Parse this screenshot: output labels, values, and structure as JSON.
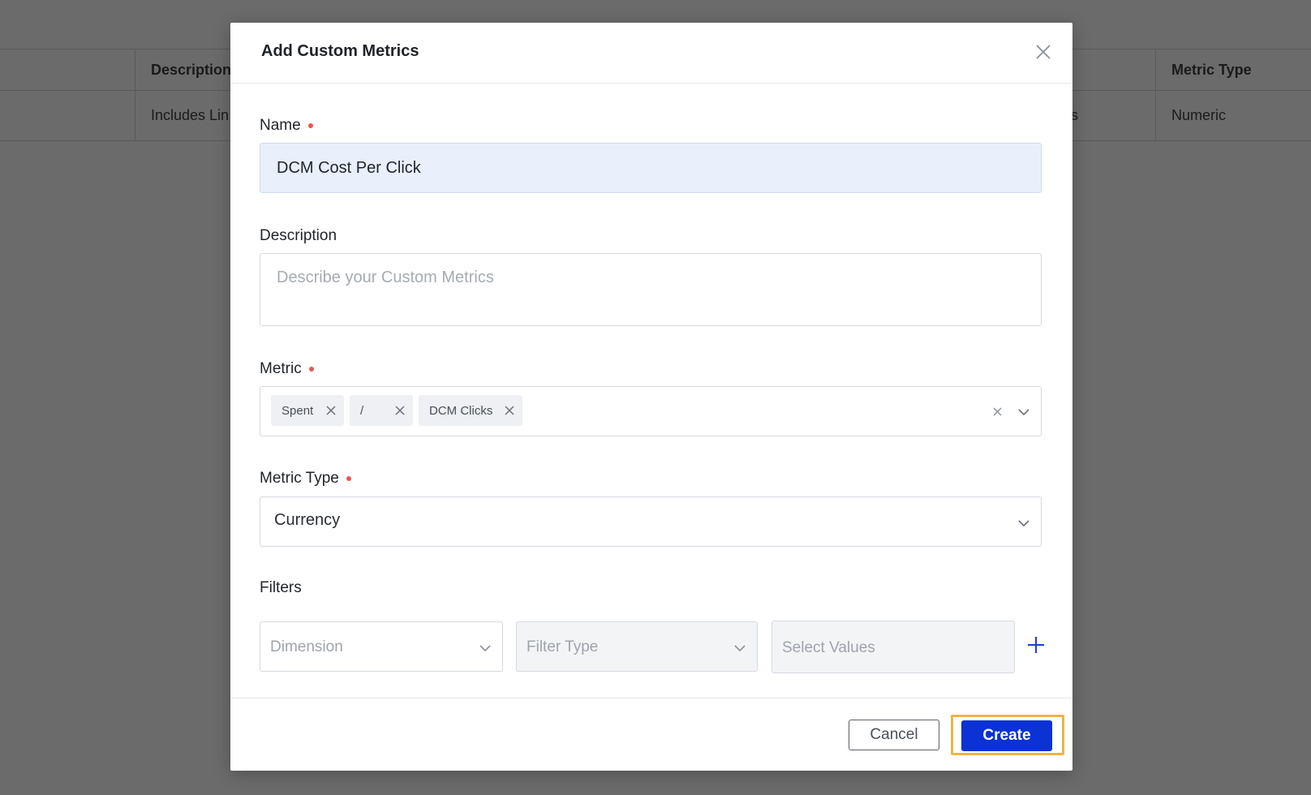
{
  "background_table": {
    "headers": {
      "description": "Description",
      "metric_type": "Metric Type"
    },
    "row": {
      "description": "Includes Lin",
      "partial": "s",
      "metric_type": "Numeric"
    }
  },
  "modal": {
    "title": "Add Custom Metrics",
    "name": {
      "label": "Name",
      "value": "DCM Cost Per Click"
    },
    "description": {
      "label": "Description",
      "placeholder": "Describe your Custom Metrics",
      "value": ""
    },
    "metric": {
      "label": "Metric",
      "chips": [
        {
          "label": "Spent"
        },
        {
          "label": "/"
        },
        {
          "label": "DCM Clicks"
        }
      ]
    },
    "metric_type": {
      "label": "Metric Type",
      "value": "Currency"
    },
    "filters": {
      "label": "Filters",
      "dimension_placeholder": "Dimension",
      "filter_type_placeholder": "Filter Type",
      "select_values_placeholder": "Select Values"
    },
    "footer": {
      "cancel_label": "Cancel",
      "create_label": "Create"
    }
  },
  "colors": {
    "primary": "#0a32d4",
    "highlight": "#f0b347",
    "required": "#e8574d",
    "overlay": "#6b6b6b"
  }
}
